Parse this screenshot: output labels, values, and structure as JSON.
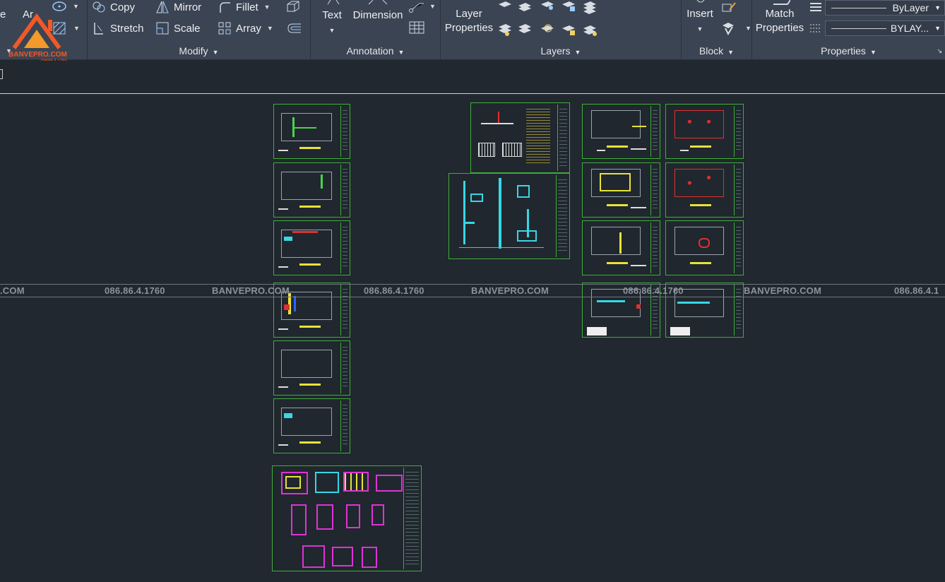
{
  "ribbon": {
    "modify": {
      "title": "Modify",
      "copy": "Copy",
      "stretch": "Stretch",
      "mirror": "Mirror",
      "scale": "Scale",
      "fillet": "Fillet",
      "array": "Array"
    },
    "annotation": {
      "title": "Annotation",
      "text": "Text",
      "dimension": "Dimension"
    },
    "layers": {
      "title": "Layers",
      "layer_properties_l1": "Layer",
      "layer_properties_l2": "Properties"
    },
    "block": {
      "title": "Block",
      "insert": "Insert"
    },
    "properties": {
      "title": "Properties",
      "match_l1": "Match",
      "match_l2": "Properties",
      "color_value": "ByLayer",
      "linetype_value": "BYLAY..."
    }
  },
  "left_partial": {
    "e_label": "e",
    "a_label": "Ar"
  },
  "logo": {
    "name": "BANVEPRO.COM",
    "phone": "08686.4.1760"
  },
  "watermark": {
    "items": [
      ".COM",
      "086.86.4.1760",
      "BANVEPRO.COM",
      "086.86.4.1760",
      "BANVEPRO.COM",
      "086.86.4.1760",
      "BANVEPRO.COM",
      "086.86.4.1"
    ]
  },
  "colors": {
    "ribbon_bg": "#3b4453",
    "canvas_bg": "#212830",
    "sheet_border": "#3fae3a",
    "accent_yellow": "#e8e23a",
    "logo_orange": "#f05a28"
  }
}
